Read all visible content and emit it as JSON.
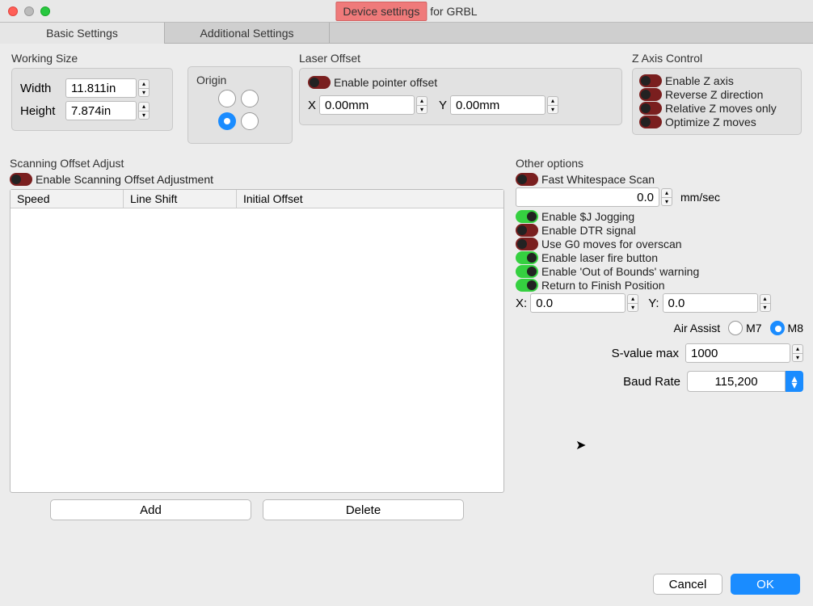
{
  "title": {
    "highlight": "Device settings",
    "rest": " for GRBL"
  },
  "tabs": {
    "basic": "Basic Settings",
    "additional": "Additional Settings"
  },
  "working": {
    "label": "Working Size",
    "width_lbl": "Width",
    "width_val": "11.811in",
    "height_lbl": "Height",
    "height_val": "7.874in"
  },
  "origin": {
    "label": "Origin"
  },
  "laser": {
    "label": "Laser Offset",
    "enable": "Enable pointer offset",
    "x_lbl": "X",
    "x_val": "0.00mm",
    "y_lbl": "Y",
    "y_val": "0.00mm"
  },
  "zaxis": {
    "label": "Z Axis Control",
    "enable": "Enable Z axis",
    "reverse": "Reverse Z direction",
    "relative": "Relative Z moves only",
    "optimize": "Optimize Z moves"
  },
  "scan": {
    "label": "Scanning Offset Adjust",
    "enable": "Enable Scanning Offset Adjustment",
    "col_speed": "Speed",
    "col_shift": "Line Shift",
    "col_init": "Initial Offset",
    "add": "Add",
    "delete": "Delete"
  },
  "other": {
    "label": "Other options",
    "fast_ws": "Fast Whitespace Scan",
    "fast_val": "0.0",
    "fast_unit": "mm/sec",
    "jog": "Enable $J Jogging",
    "dtr": "Enable DTR signal",
    "g0": "Use G0 moves for overscan",
    "fire": "Enable laser fire button",
    "oob": "Enable 'Out of Bounds' warning",
    "rfp": "Return to Finish Position",
    "x_lbl": "X:",
    "x_val": "0.0",
    "y_lbl": "Y:",
    "y_val": "0.0",
    "air_lbl": "Air Assist",
    "m7": "M7",
    "m8": "M8",
    "sval_lbl": "S-value max",
    "sval": "1000",
    "baud_lbl": "Baud Rate",
    "baud": "115,200"
  },
  "buttons": {
    "cancel": "Cancel",
    "ok": "OK"
  }
}
